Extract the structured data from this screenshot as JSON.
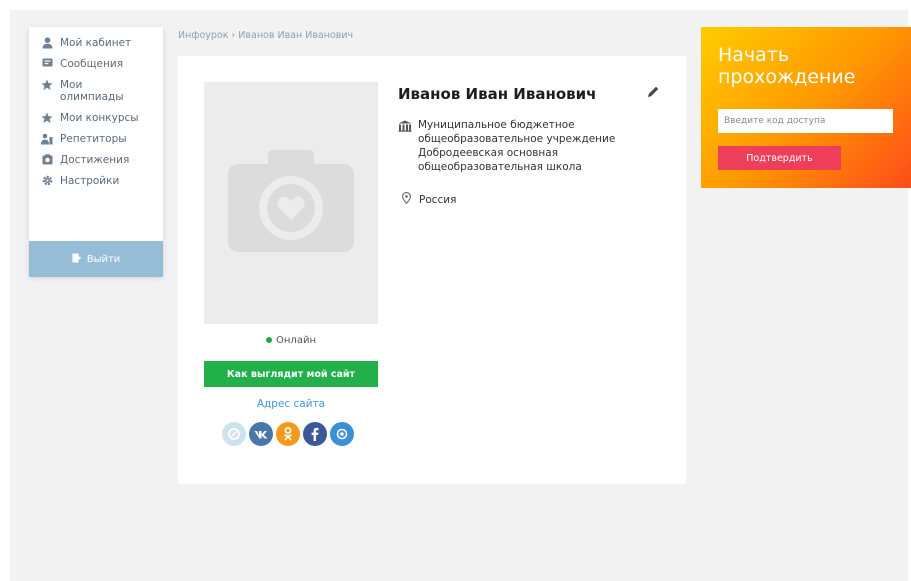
{
  "sidebar": {
    "items": [
      {
        "label": "Мой кабинет",
        "icon": "user-icon"
      },
      {
        "label": "Сообщения",
        "icon": "message-icon"
      },
      {
        "label": "Мои олимпиады",
        "icon": "star-icon"
      },
      {
        "label": "Мои конкурсы",
        "icon": "star-icon"
      },
      {
        "label": "Репетиторы",
        "icon": "tutors-icon"
      },
      {
        "label": "Достижения",
        "icon": "achievement-icon"
      },
      {
        "label": "Настройки",
        "icon": "gear-icon"
      }
    ],
    "logout_label": "Выйти"
  },
  "breadcrumb": "Инфоурок › Иванов Иван Иванович",
  "profile": {
    "name": "Иванов Иван Иванович",
    "organization": "Муниципальное бюджетное общеобразовательное учреждение Добродеевская основная общеобразовательная школа",
    "country": "Россия",
    "status": "Онлайн",
    "site_button": "Как выглядит мой сайт",
    "site_link": "Адрес сайта"
  },
  "start": {
    "title": "Начать прохождение",
    "input_placeholder": "Введите код доступа",
    "confirm_label": "Подтвердить"
  },
  "colors": {
    "online": "#21a93f",
    "site_button": "#21b04a",
    "confirm_button": "#ee3e5a",
    "logout": "#95bdd7",
    "vk": "#4a76a8",
    "ok": "#f59a1a",
    "facebook": "#3b5998"
  }
}
